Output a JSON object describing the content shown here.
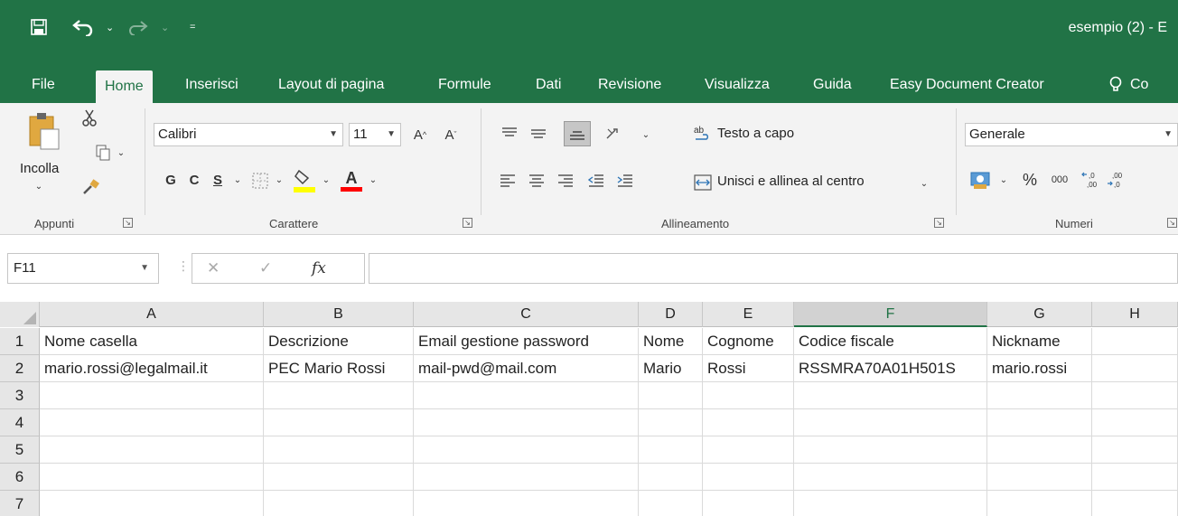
{
  "quick_access": {
    "save_icon": "save-icon",
    "undo_icon": "undo-icon",
    "redo_icon": "redo-icon",
    "dropdown": "⌄",
    "customize": "="
  },
  "window": {
    "title": "esempio (2)  -  E"
  },
  "tabs": [
    "File",
    "Home",
    "Inserisci",
    "Layout di pagina",
    "Formule",
    "Dati",
    "Revisione",
    "Visualizza",
    "Guida",
    "Easy Document Creator"
  ],
  "tell_me": {
    "icon": "lightbulb-icon",
    "label": "Co"
  },
  "ribbon": {
    "clipboard": {
      "paste_label": "Incolla",
      "group_label": "Appunti"
    },
    "font": {
      "font_name": "Calibri",
      "font_size": "11",
      "grow": "A",
      "shrink": "A",
      "bold": "G",
      "italic": "C",
      "underline": "S",
      "font_color_letter": "A",
      "group_label": "Carattere",
      "highlight_color": "#ffff00",
      "font_color": "#ff0000"
    },
    "alignment": {
      "wrap_text": "Testo a capo",
      "merge_center": "Unisci e allinea al centro",
      "group_label": "Allineamento"
    },
    "number": {
      "format": "Generale",
      "percent": "%",
      "thousands": "000",
      "inc_decimal": "←,0 ,00",
      "group_label": "Numeri"
    }
  },
  "formula_bar": {
    "name_box": "F11",
    "cancel": "✕",
    "enter": "✓",
    "fx": "fx",
    "value": ""
  },
  "sheet": {
    "columns": [
      "A",
      "B",
      "C",
      "D",
      "E",
      "F",
      "G",
      "H"
    ],
    "selected_column": "F",
    "rows": [
      {
        "num": "1",
        "cells": [
          "Nome casella",
          "Descrizione",
          "Email gestione password",
          "Nome",
          "Cognome",
          "Codice fiscale",
          "Nickname",
          ""
        ]
      },
      {
        "num": "2",
        "cells": [
          "mario.rossi@legalmail.it",
          "PEC Mario Rossi",
          "mail-pwd@mail.com",
          "Mario",
          "Rossi",
          "RSSMRA70A01H501S",
          "mario.rossi",
          ""
        ]
      },
      {
        "num": "3",
        "cells": [
          "",
          "",
          "",
          "",
          "",
          "",
          "",
          ""
        ]
      },
      {
        "num": "4",
        "cells": [
          "",
          "",
          "",
          "",
          "",
          "",
          "",
          ""
        ]
      },
      {
        "num": "5",
        "cells": [
          "",
          "",
          "",
          "",
          "",
          "",
          "",
          ""
        ]
      },
      {
        "num": "6",
        "cells": [
          "",
          "",
          "",
          "",
          "",
          "",
          "",
          ""
        ]
      },
      {
        "num": "7",
        "cells": [
          "",
          "",
          "",
          "",
          "",
          "",
          "",
          ""
        ]
      }
    ]
  },
  "colors": {
    "excel_green": "#217346",
    "ribbon_bg": "#f3f3f3",
    "header_bg": "#e6e6e6"
  }
}
